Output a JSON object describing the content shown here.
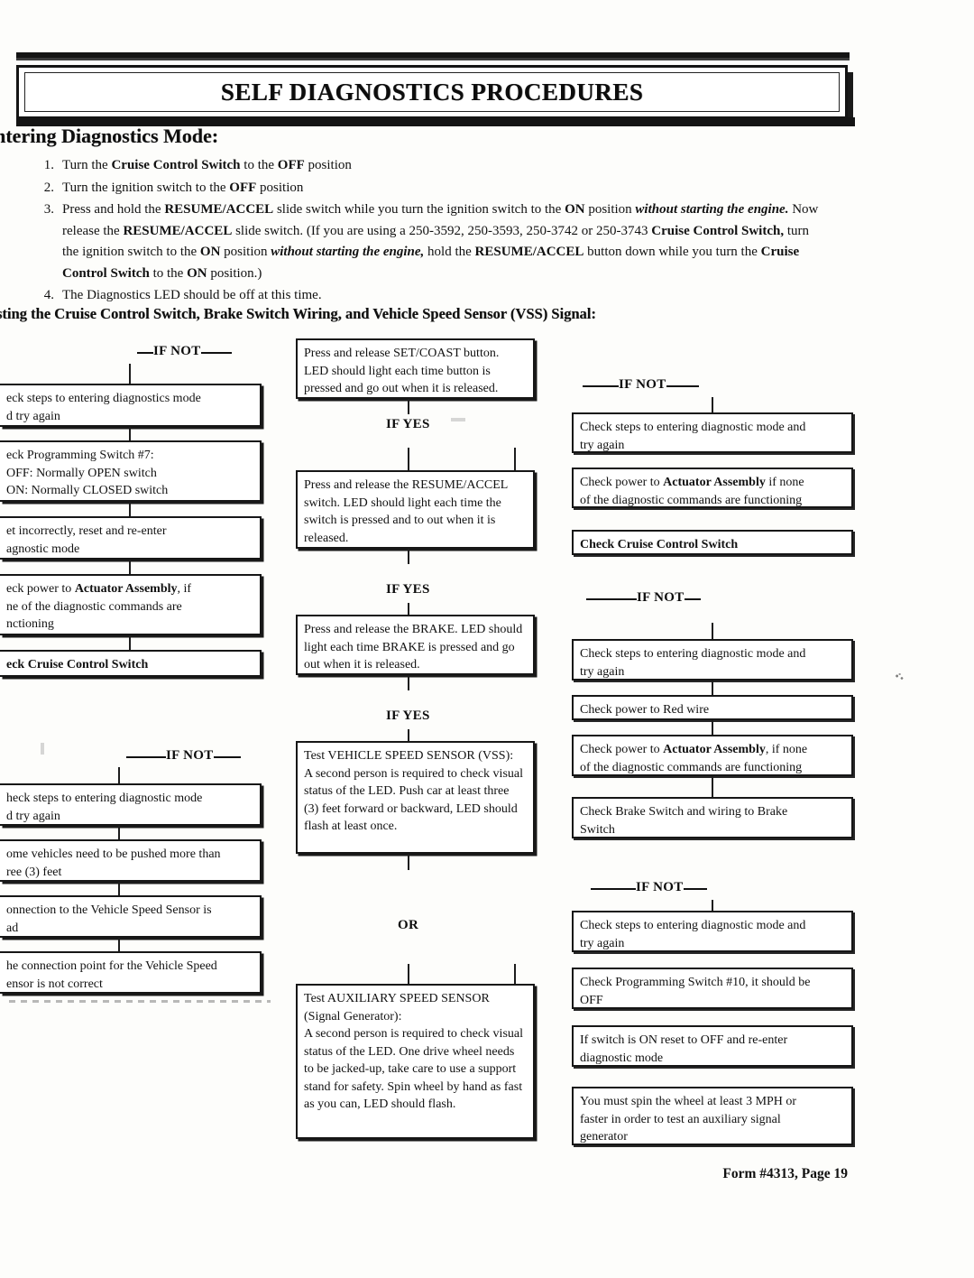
{
  "document": {
    "banner_title": "SELF DIAGNOSTICS PROCEDURES",
    "entering_heading": "ntering Diagnostics Mode:",
    "testing_heading": "sting the Cruise Control Switch, Brake Switch Wiring, and Vehicle Speed Sensor (VSS) Signal:",
    "footer": "Form #4313, Page 19"
  },
  "steps": [
    {
      "num": "1.",
      "html": "Turn the <b>Cruise Control Switch</b> to the <b>OFF</b> position"
    },
    {
      "num": "2.",
      "html": "Turn the ignition switch to the <b>OFF</b> position"
    },
    {
      "num": "3.",
      "html": "Press and hold the <b>RESUME/ACCEL</b> slide switch while you turn the ignition switch to the <b>ON</b> position <i>without starting the engine.</i> Now release the <b>RESUME/ACCEL</b> slide switch. (If you are using a 250-3592, 250-3593, 250-3742 or 250-3743 <b>Cruise Control Switch,</b> turn the ignition switch to the <b>ON</b> position <i>without starting the engine,</i> hold the <b>RESUME/ACCEL</b> button down while you turn the <b>Cruise Control Switch</b> to the <b>ON</b> position.)"
    },
    {
      "num": "4.",
      "html": "The Diagnostics LED should be off at this time."
    }
  ],
  "labels": {
    "if_not": "IF NOT",
    "if_yes": "IF YES",
    "or": "OR"
  },
  "center_column": {
    "boxes": [
      {
        "id": "set-coast",
        "html": "Press and release SET/COAST button. LED should light each time button is pressed and go out when it is released."
      },
      {
        "id": "resume-accel",
        "html": "Press and release the RESUME/ACCEL switch. LED should light each time the switch is pressed and to out when it is released."
      },
      {
        "id": "brake",
        "html": "Press and release the BRAKE. LED should light each time BRAKE is pressed and go out when it is released."
      },
      {
        "id": "vss",
        "html": "Test VEHICLE SPEED SENSOR (VSS):<br>A second person is required to check visual status of the LED. Push car at least three (3) feet forward or backward, LED should flash at least once."
      },
      {
        "id": "auxiliary",
        "html": "Test AUXILIARY SPEED SENSOR (Signal Generator):<br>A second person is required to check visual status of the LED. One drive wheel needs to be jacked-up, take care to use a support stand for safety. Spin wheel by hand as fast as you can, LED should flash."
      }
    ]
  },
  "left_column": {
    "group1": [
      {
        "html": "eck steps to entering diagnostics mode<br>d try again"
      },
      {
        "html": "eck Programming Switch #7:<br>OFF: Normally OPEN switch<br>ON: Normally CLOSED switch"
      },
      {
        "html": "et incorrectly, reset and re-enter<br>agnostic mode"
      },
      {
        "html": "eck power to <b>Actuator Assembly</b>, if<br>ne of the diagnostic commands are<br>nctioning"
      },
      {
        "html": "<b>eck Cruise Control Switch</b>"
      }
    ],
    "group2": [
      {
        "html": "heck steps to entering diagnostic mode<br>d try again"
      },
      {
        "html": "ome vehicles need to be pushed more than<br>ree (3) feet"
      },
      {
        "html": "onnection to the Vehicle Speed Sensor is<br>ad"
      },
      {
        "html": "he connection point for the Vehicle Speed<br>ensor is not correct"
      }
    ]
  },
  "right_column": {
    "group1": [
      {
        "html": "Check steps to entering diagnostic mode and<br>try again"
      },
      {
        "html": "Check power to <b>Actuator Assembly</b> if none<br>of the diagnostic commands are functioning"
      },
      {
        "html": "<b>Check Cruise Control Switch</b>"
      }
    ],
    "group2": [
      {
        "html": "Check steps to entering diagnostic mode and<br>try again"
      },
      {
        "html": "Check power to Red wire"
      },
      {
        "html": "Check power to <b>Actuator Assembly</b>, if none<br>of the diagnostic commands are functioning"
      },
      {
        "html": "Check Brake Switch and wiring to Brake<br>Switch"
      }
    ],
    "group3": [
      {
        "html": "Check steps to entering diagnostic mode and<br>try again"
      },
      {
        "html": "Check Programming Switch #10, it should be<br>OFF"
      },
      {
        "html": "If switch is ON reset to OFF and re-enter<br>diagnostic mode"
      },
      {
        "html": "You must spin the wheel at least 3 MPH or<br>faster in order to test an auxiliary signal<br>generator"
      }
    ]
  }
}
